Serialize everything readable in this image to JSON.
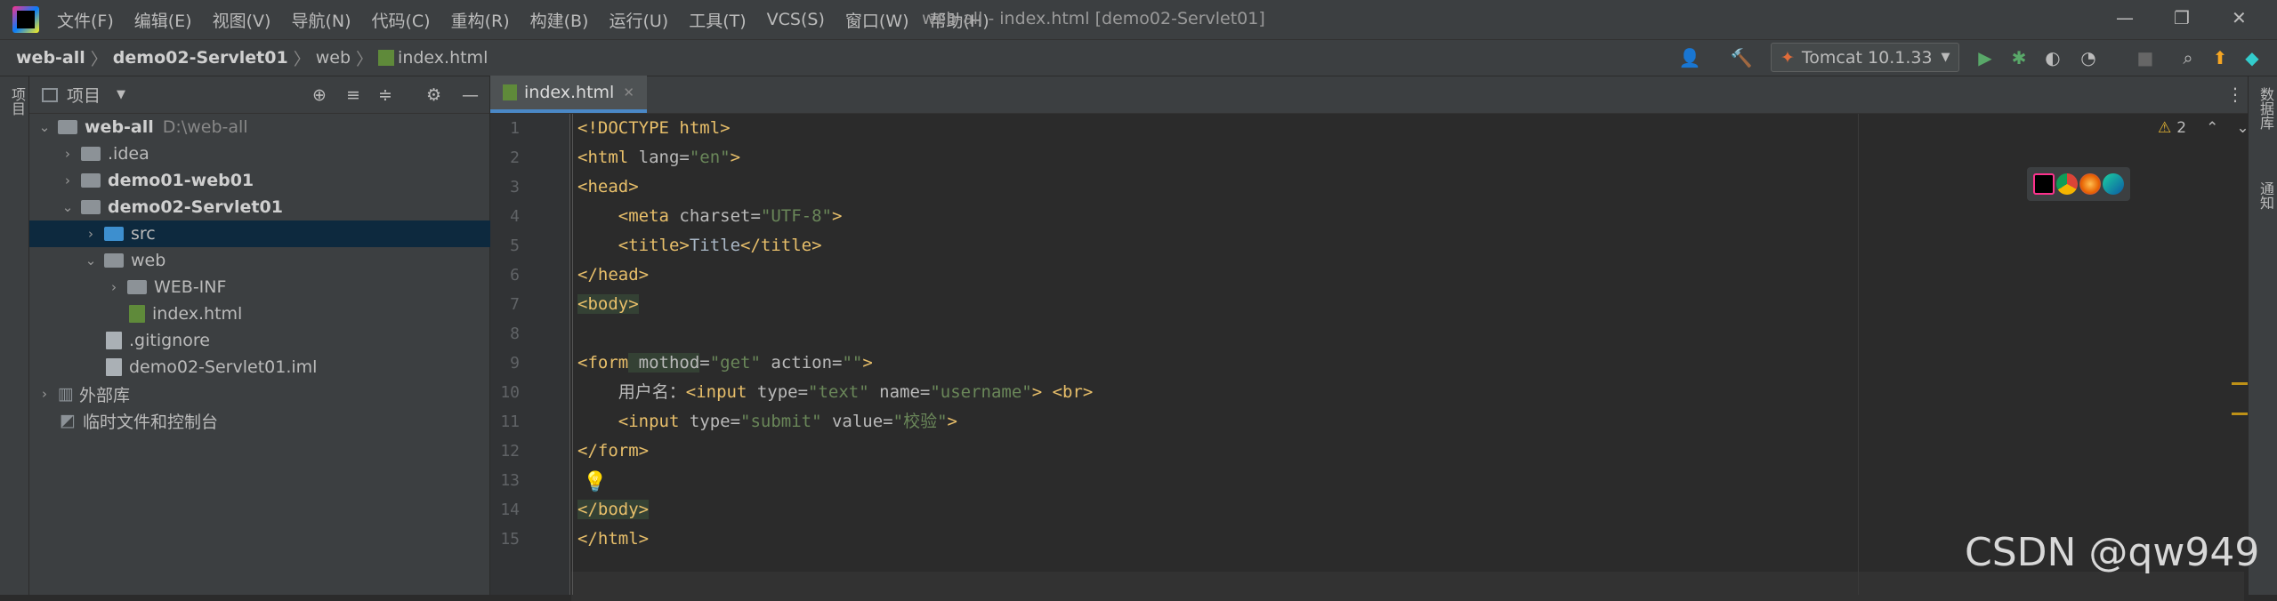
{
  "menu": {
    "items": [
      "文件(F)",
      "编辑(E)",
      "视图(V)",
      "导航(N)",
      "代码(C)",
      "重构(R)",
      "构建(B)",
      "运行(U)",
      "工具(T)",
      "VCS(S)",
      "窗口(W)",
      "帮助(H)"
    ],
    "window_title": "web-all - index.html [demo02-Servlet01]"
  },
  "breadcrumb": [
    "web-all",
    "demo02-Servlet01",
    "web",
    "index.html"
  ],
  "toolbar": {
    "run_config": "Tomcat 10.1.33"
  },
  "left_strip": {
    "project_label": "项目"
  },
  "right_strip": {
    "database_label": "数据库",
    "notifications_label": "通知"
  },
  "project": {
    "title": "项目",
    "tree": [
      {
        "label": "web-all",
        "hint": "D:\\web-all",
        "bold": true
      },
      {
        "label": ".idea"
      },
      {
        "label": "demo01-web01",
        "bold": true
      },
      {
        "label": "demo02-Servlet01",
        "bold": true
      },
      {
        "label": "src"
      },
      {
        "label": "web"
      },
      {
        "label": "WEB-INF"
      },
      {
        "label": "index.html"
      },
      {
        "label": ".gitignore"
      },
      {
        "label": "demo02-Servlet01.iml"
      },
      {
        "label": "外部库"
      },
      {
        "label": "临时文件和控制台"
      }
    ]
  },
  "editor": {
    "tab": "index.html",
    "warnings": "2",
    "line_numbers": [
      "1",
      "2",
      "3",
      "4",
      "5",
      "6",
      "7",
      "8",
      "9",
      "10",
      "11",
      "12",
      "13",
      "14",
      "15"
    ],
    "lines": [
      [
        "<!DOCTYPE html>"
      ],
      [
        "<html",
        " lang=",
        "\"en\"",
        ">"
      ],
      [
        "<head>"
      ],
      [
        "    <meta",
        " charset=",
        "\"UTF-8\"",
        ">"
      ],
      [
        "    <title>",
        "Title",
        "</title>"
      ],
      [
        "</head>"
      ],
      [
        "<body>"
      ],
      [
        ""
      ],
      [
        "<form",
        " mothod",
        "=",
        "\"get\"",
        " action=",
        "\"\"",
        ">"
      ],
      [
        "    用户名：",
        "<input",
        " type=",
        "\"text\"",
        " name=",
        "\"username\"",
        "> <br>"
      ],
      [
        "    <input",
        " type=",
        "\"submit\"",
        " value=",
        "\"校验\"",
        ">"
      ],
      [
        "</form>"
      ],
      [
        ""
      ],
      [
        "</body>"
      ],
      [
        "</html>"
      ]
    ]
  },
  "watermark": "CSDN @qw949"
}
